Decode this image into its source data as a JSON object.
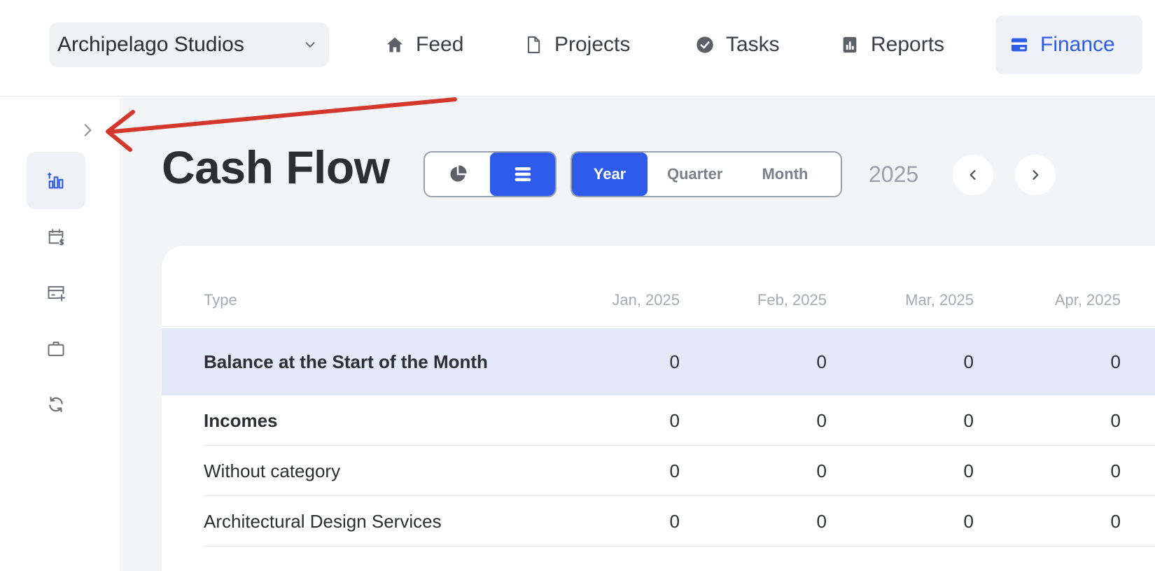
{
  "workspace": {
    "name": "Archipelago Studios"
  },
  "nav": {
    "feed": "Feed",
    "projects": "Projects",
    "tasks": "Tasks",
    "reports": "Reports",
    "finance": "Finance",
    "active": "Finance"
  },
  "sidebar": {
    "items": [
      {
        "icon": "cash-flow-chart-icon",
        "active": true
      },
      {
        "icon": "calendar-dollar-icon",
        "active": false
      },
      {
        "icon": "card-add-icon",
        "active": false
      },
      {
        "icon": "briefcase-icon",
        "active": false
      },
      {
        "icon": "refresh-icon",
        "active": false
      }
    ]
  },
  "page": {
    "title": "Cash Flow",
    "view_modes": [
      "pie-chart-icon",
      "list-icon"
    ],
    "active_view": "list",
    "periods": [
      "Year",
      "Quarter",
      "Month"
    ],
    "active_period": "Year",
    "year": "2025"
  },
  "table": {
    "headers": [
      "Type",
      "Jan, 2025",
      "Feb, 2025",
      "Mar, 2025",
      "Apr, 2025"
    ],
    "rows": [
      {
        "type": "Balance at the Start of the Month",
        "values": [
          "0",
          "0",
          "0",
          "0"
        ],
        "bold": true,
        "highlight": true
      },
      {
        "type": "Incomes",
        "values": [
          "0",
          "0",
          "0",
          "0"
        ],
        "bold": true
      },
      {
        "type": "Without category",
        "values": [
          "0",
          "0",
          "0",
          "0"
        ]
      },
      {
        "type": "Architectural Design Services",
        "values": [
          "0",
          "0",
          "0",
          "0"
        ]
      }
    ]
  },
  "colors": {
    "accent": "#2f5bea",
    "annotation": "#d4382c",
    "highlight_row": "#e3e9f8"
  }
}
